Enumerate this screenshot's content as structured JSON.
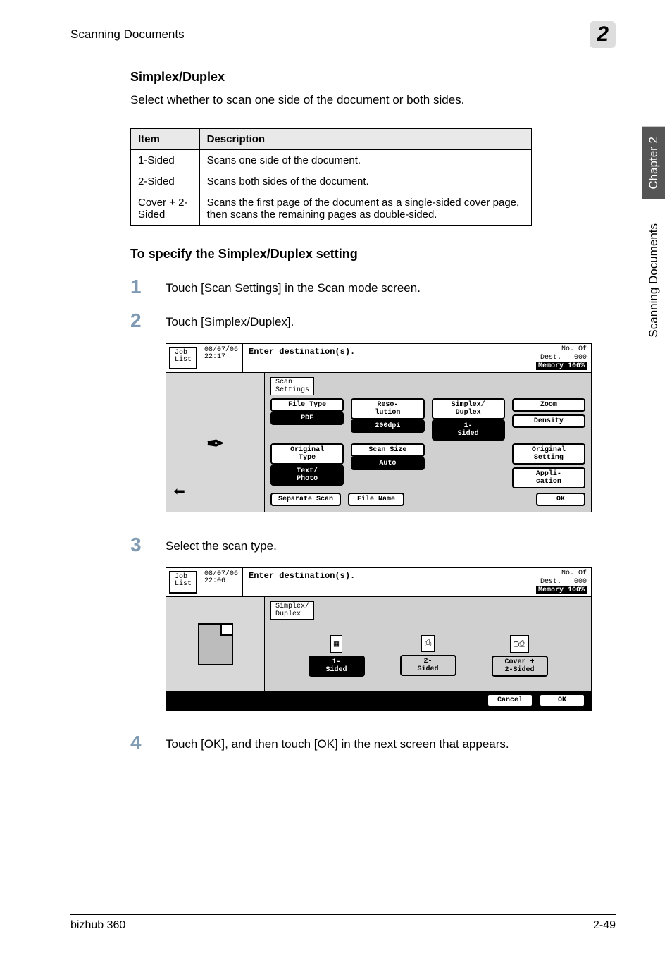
{
  "header": {
    "title": "Scanning Documents",
    "chapter_num": "2"
  },
  "section": {
    "title": "Simplex/Duplex",
    "intro": "Select whether to scan one side of the document or both sides."
  },
  "table": {
    "head": [
      "Item",
      "Description"
    ],
    "rows": [
      [
        "1-Sided",
        "Scans one side of the document."
      ],
      [
        "2-Sided",
        "Scans both sides of the document."
      ],
      [
        "Cover + 2-Sided",
        "Scans the first page of the document as a single-sided cover page, then scans the remaining pages as double-sided."
      ]
    ]
  },
  "procedure": {
    "title": "To specify the Simplex/Duplex setting",
    "steps": [
      "Touch [Scan Settings] in the Scan mode screen.",
      "Touch [Simplex/Duplex].",
      "Select the scan type.",
      "Touch [OK], and then touch [OK] in the next screen that appears."
    ]
  },
  "screen1": {
    "job_list": "Job\nList",
    "timestamp": "08/07/06\n22:17",
    "enter_dest": "Enter destination(s).",
    "dest_label": "No. Of\nDest.",
    "dest_count": "000",
    "memory": "Memory 100%",
    "tab": "Scan\nSettings",
    "file_type": "File Type",
    "file_type_val": "PDF",
    "resolution": "Reso-\nlution",
    "resolution_val": "200dpi",
    "simplex": "Simplex/\nDuplex",
    "simplex_val": "1-\nSided",
    "orig_type": "Original\nType",
    "orig_type_val": "Text/\nPhoto",
    "scan_size": "Scan Size",
    "scan_size_val": "Auto",
    "zoom": "Zoom",
    "density": "Density",
    "orig_setting": "Original\nSetting",
    "application": "Appli-\ncation",
    "separate": "Separate\nScan",
    "file_name": "File\nName",
    "ok": "OK"
  },
  "screen2": {
    "job_list": "Job\nList",
    "timestamp": "08/07/06\n22:06",
    "enter_dest": "Enter destination(s).",
    "dest_label": "No. Of\nDest.",
    "dest_count": "000",
    "memory": "Memory 100%",
    "tab": "Simplex/\nDuplex",
    "opt1": "1-\nSided",
    "opt2": "2-\nSided",
    "opt3": "Cover +\n2-Sided",
    "cancel": "Cancel",
    "ok": "OK"
  },
  "side": {
    "chapter": "Chapter 2",
    "section": "Scanning Documents"
  },
  "footer": {
    "left": "bizhub 360",
    "right": "2-49"
  }
}
